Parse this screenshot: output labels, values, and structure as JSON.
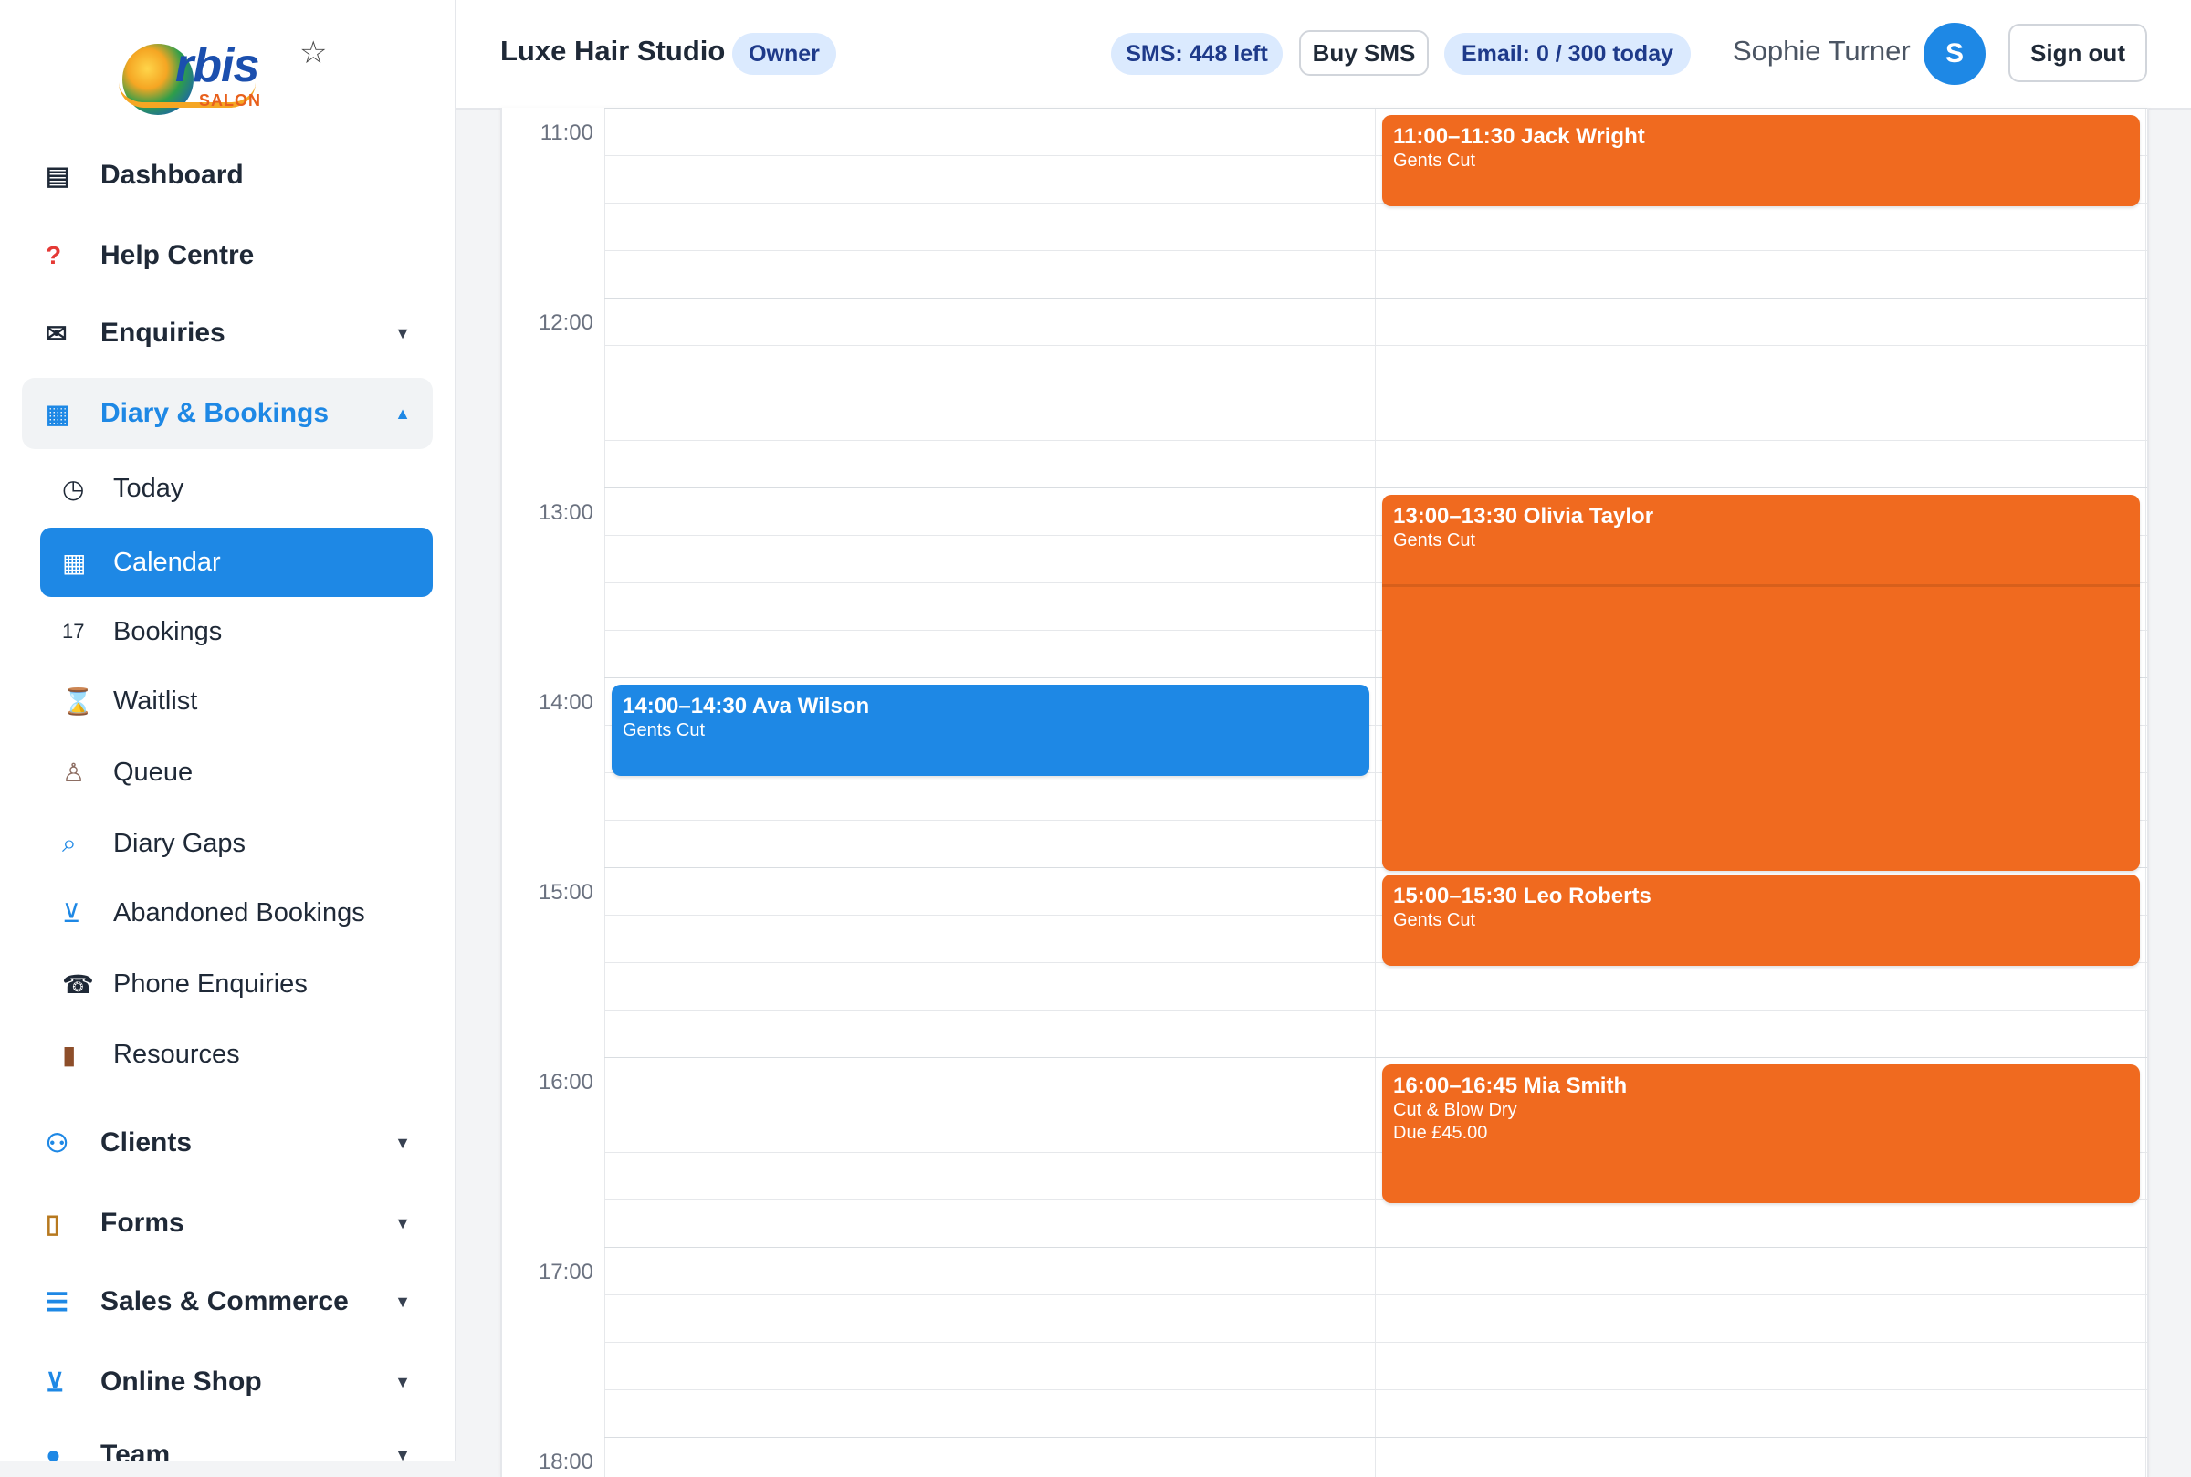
{
  "app": {
    "logo_text": "rbis",
    "logo_sub": "SALON"
  },
  "sidebar": {
    "items": [
      {
        "label": "Dashboard",
        "icon": "dashboard-icon"
      },
      {
        "label": "Help Centre",
        "icon": "help-icon"
      },
      {
        "label": "Enquiries",
        "icon": "mail-icon"
      },
      {
        "label": "Diary & Bookings",
        "icon": "calendar-icon"
      },
      {
        "label": "Clients",
        "icon": "users-icon"
      },
      {
        "label": "Forms",
        "icon": "clipboard-icon"
      },
      {
        "label": "Sales & Commerce",
        "icon": "receipt-icon"
      },
      {
        "label": "Online Shop",
        "icon": "cart-icon"
      },
      {
        "label": "Team",
        "icon": "person-icon"
      }
    ],
    "diary_sub": [
      {
        "label": "Today",
        "icon": "clock-icon"
      },
      {
        "label": "Calendar",
        "icon": "calendar-icon"
      },
      {
        "label": "Bookings",
        "icon": "date-icon"
      },
      {
        "label": "Waitlist",
        "icon": "hourglass-icon"
      },
      {
        "label": "Queue",
        "icon": "walking-icon"
      },
      {
        "label": "Diary Gaps",
        "icon": "search-icon"
      },
      {
        "label": "Abandoned Bookings",
        "icon": "cart-icon"
      },
      {
        "label": "Phone Enquiries",
        "icon": "phone-icon"
      },
      {
        "label": "Resources",
        "icon": "door-icon"
      }
    ]
  },
  "header": {
    "studio": "Luxe Hair Studio",
    "role": "Owner",
    "sms": "SMS: 448 left",
    "buy_sms": "Buy SMS",
    "email": "Email: 0 / 300 today",
    "user": "Sophie Turner",
    "avatar": "S",
    "sign_out": "Sign out"
  },
  "calendar": {
    "times": [
      "11:00",
      "12:00",
      "13:00",
      "14:00",
      "15:00",
      "16:00",
      "17:00",
      "18:00"
    ],
    "events": [
      {
        "title": "11:00–11:30 Jack Wright",
        "service": "Gents Cut",
        "extra": "",
        "color": "#f06a1f"
      },
      {
        "title": "13:00–13:30 Olivia Taylor",
        "service": "Gents Cut",
        "extra": "",
        "color": "#f06a1f"
      },
      {
        "title": "14:00–14:30 Ava Wilson",
        "service": "Gents Cut",
        "extra": "",
        "color": "#1e88e5"
      },
      {
        "title": "15:00–15:30 Leo Roberts",
        "service": "Gents Cut",
        "extra": "",
        "color": "#f06a1f"
      },
      {
        "title": "16:00–16:45 Mia Smith",
        "service": "Cut & Blow Dry",
        "extra": "Due £45.00",
        "color": "#f06a1f"
      }
    ]
  },
  "colors": {
    "accent": "#1e88e5",
    "booking_orange": "#f06a1f",
    "pill_bg": "#dbeafe"
  }
}
